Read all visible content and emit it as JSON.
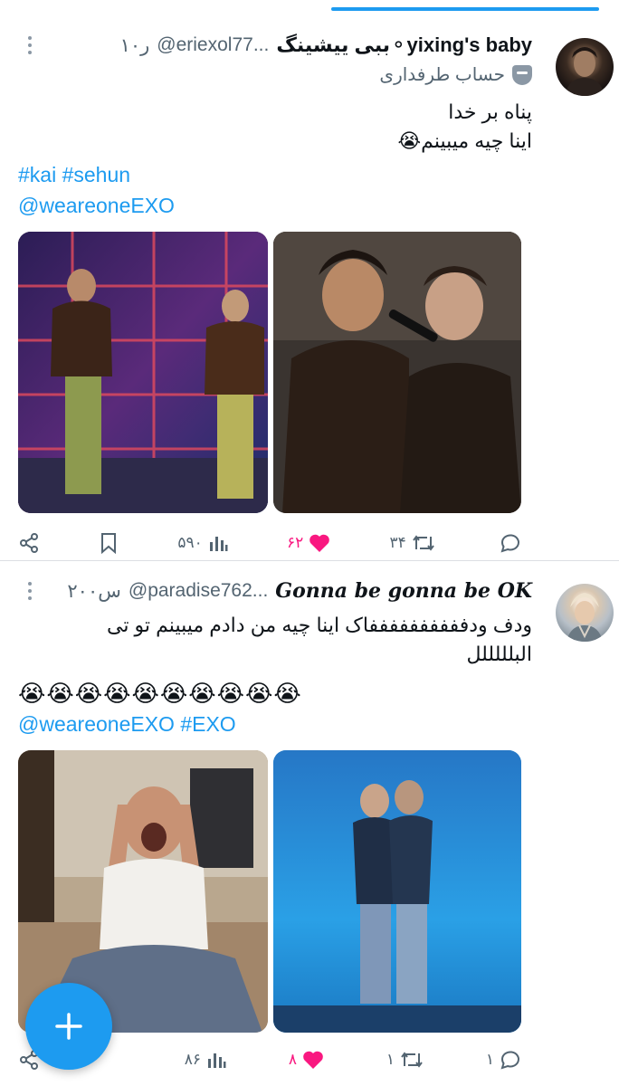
{
  "tweets": [
    {
      "display_name": "ببی ییشینگ⚬yixing's baby",
      "handle": "@eriexol77...",
      "time": "۱۰ر",
      "label": "حساب طرفداری",
      "text_lines": [
        "پناه بر خدا",
        "اینا چیه میبینم😭"
      ],
      "hashtags": "#kai #sehun",
      "mention": "@weareoneEXO",
      "stats": {
        "views": "۵۹۰",
        "likes": "۶۲",
        "reposts": "۳۴",
        "replies": ""
      }
    },
    {
      "display_name": "Gonna be gonna be OK",
      "handle": "@paradise762...",
      "time": "۲۰۰س",
      "text_lines": [
        "ودف ودففففففففففاک اینا چیه من دادم میبینم تو تی",
        "البلللللل"
      ],
      "emojis": "😭😭😭😭😭😭😭😭😭😭",
      "mention_hashtag": "@weareoneEXO #EXO",
      "stats": {
        "views": "۸۶",
        "likes": "۸",
        "reposts": "۱",
        "replies": "۱"
      }
    }
  ],
  "colors": {
    "accent": "#1d9bf0",
    "like": "#f91880",
    "muted": "#536471"
  },
  "icons": [
    "share-icon",
    "bookmark-icon",
    "views-icon",
    "heart-icon",
    "repost-icon",
    "reply-icon",
    "plus-icon",
    "kebab-menu-icon"
  ]
}
